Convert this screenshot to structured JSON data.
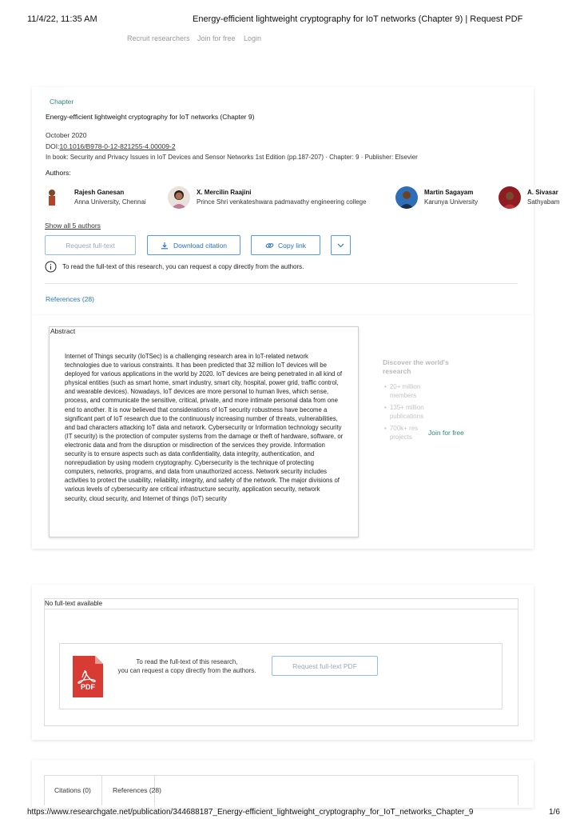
{
  "print_header": {
    "datetime": "11/4/22, 11:35 AM",
    "title": "Energy-efficient lightweight cryptography for IoT networks (Chapter 9) | Request PDF"
  },
  "top_nav": {
    "recruit": "Recruit researchers",
    "join": "Join for free",
    "login": "Login"
  },
  "publication": {
    "type": "Chapter",
    "title": "Energy-efficient lightweight cryptography for IoT networks (Chapter 9)",
    "date": "October 2020",
    "doi_label": "DOI:",
    "doi": "10.1016/B978-0-12-821255-4.00009-2",
    "book_info": "In book: Security and Privacy Issues in IoT Devices and Sensor Networks 1st Edition (pp.187-207) · Chapter: 9 · Publisher: Elsevier",
    "authors_label": "Authors:",
    "authors": [
      {
        "name": "Rajesh Ganesan",
        "affiliation": "Anna University, Chennai"
      },
      {
        "name": "X. Mercilin Raajini",
        "affiliation": "Prince Shri venkateshwara padmavathy engineering college"
      },
      {
        "name": "Martin Sagayam",
        "affiliation": "Karunya University"
      },
      {
        "name": "A. Sivasar",
        "affiliation": "Sathyabam"
      }
    ],
    "show_all": "Show all 5 authors"
  },
  "actions": {
    "request": "Request full-text",
    "download": "Download citation",
    "copy": "Copy link",
    "info_text": "To read the full-text of this research, you can request a copy directly from the authors."
  },
  "references_link": "References (28)",
  "abstract": {
    "label": "Abstract",
    "text": "Internet of Things security (IoTSec) is a challenging research area in IoT-related network technologies due to various constraints. It has been predicted that 32 million IoT devices will be deployed for various applications in the world by 2020. IoT devices are being penetrated in all kind of physical entities (such as smart home, smart industry, smart city, hospital, power grid, traffic control, and wearable devices). Nowadays, IoT devices are more personal to human lives, which sense, process, and communicate the sensitive, critical, private, and more intimate personal data from one end to another. It is now believed that considerations of IoT security robustness have become a significant part of IoT research due to the continuously increasing number of threats, vulnerabilities, and bad characters attacking IoT data and network. Cybersecurity or Information technology security (IT security) is the protection of computer systems from the damage or theft of hardware, software, or electronic data and from the disruption or misdirection of the services they provide. Information security is to ensure aspects such as data confidentiality, data integrity, authentication, and nonrepudiation by using modern cryptography. Cybersecurity is the technique of protecting computers, networks, programs, and data from unauthorized access. Network security includes activities to protect the usability, reliability, integrity, and safety of the network. The major divisions of various levels of cybersecurity are critical infrastructure security, application security, network security, cloud security, and Internet of things (IoT) security"
  },
  "sidebar": {
    "title": "Discover the world's research",
    "items": [
      "20+ million members",
      "135+ million publications",
      "700k+ res projects"
    ],
    "join": "Join for free"
  },
  "fulltext": {
    "label": "No full-text available",
    "text_line1": "To read the full-text of this research,",
    "text_line2": "you can request a copy directly from the authors.",
    "button": "Request full-text PDF",
    "pdf_label": "PDF"
  },
  "tabs": {
    "citations": "Citations (0)",
    "references": "References (28)"
  },
  "print_footer": {
    "url": "https://www.researchgate.net/publication/344688187_Energy-efficient_lightweight_cryptography_for_IoT_networks_Chapter_9",
    "page": "1/6"
  }
}
